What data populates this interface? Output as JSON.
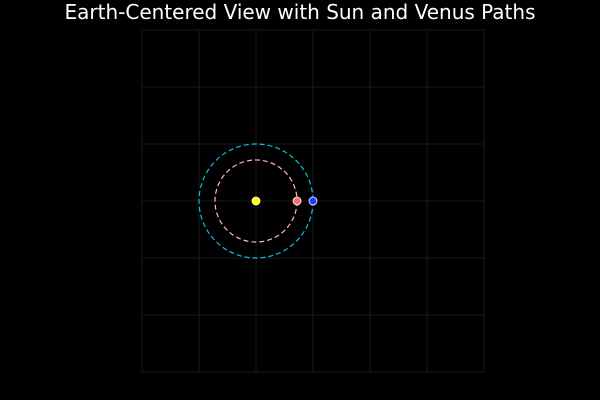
{
  "chart_data": {
    "type": "scatter",
    "title": "Earth-Centered View with Sun and Venus Paths",
    "xlabel": "",
    "ylabel": "",
    "xlim": [
      -2,
      4
    ],
    "ylim": [
      -3,
      3
    ],
    "grid": true,
    "legend": "none",
    "series": [
      {
        "kind": "path",
        "style": "dashed",
        "color": "#00c8d8",
        "center": [
          0,
          0
        ],
        "radius": 1.0
      },
      {
        "kind": "path",
        "style": "dashed",
        "color": "#ffb6c1",
        "center": [
          0,
          0
        ],
        "radius": 0.72
      },
      {
        "kind": "point",
        "color": "#ffff00",
        "x": 0,
        "y": 0
      },
      {
        "kind": "point",
        "color": "#ff6b6b",
        "x": 0.72,
        "y": 0
      },
      {
        "kind": "point",
        "color": "#1a3cff",
        "x": 1.0,
        "y": 0
      }
    ],
    "colors": {
      "background": "#000000",
      "grid": "#1a1a1a",
      "title": "#ffffff",
      "marker_stroke": "#ffffff"
    }
  }
}
